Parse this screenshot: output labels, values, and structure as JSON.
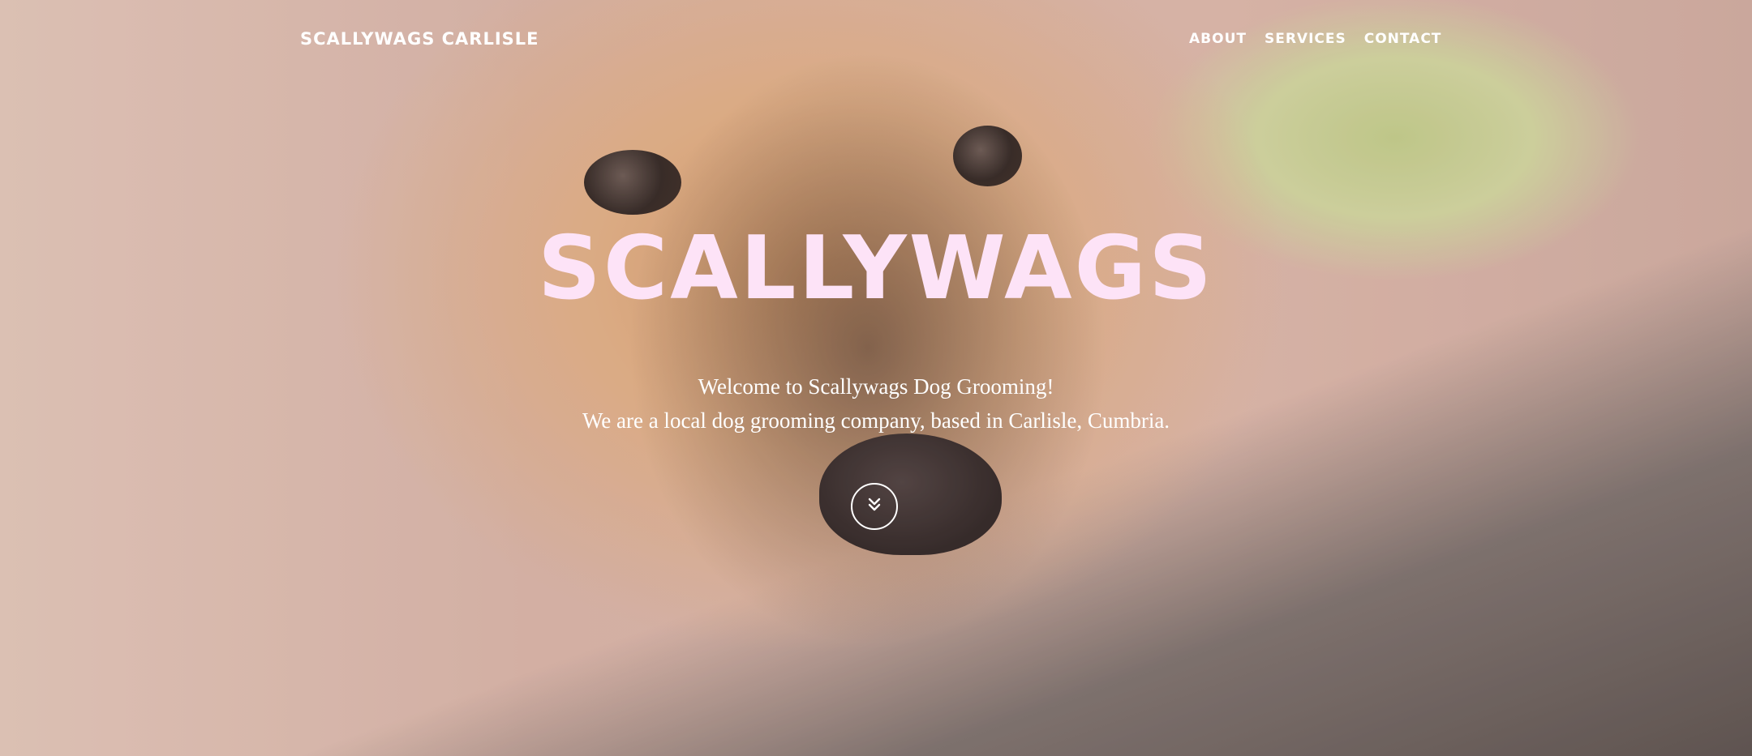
{
  "nav": {
    "brand": "SCALLYWAGS CARLISLE",
    "links": [
      {
        "label": "ABOUT"
      },
      {
        "label": "SERVICES"
      },
      {
        "label": "CONTACT"
      }
    ]
  },
  "hero": {
    "title": "SCALLYWAGS",
    "lines": [
      "Welcome to Scallywags Dog Grooming!",
      "We are a local dog grooming company, based in Carlisle, Cumbria."
    ],
    "scroll_icon": "double-chevron-down-icon"
  },
  "colors": {
    "title": "#fde3f7",
    "text": "#ffffff"
  }
}
